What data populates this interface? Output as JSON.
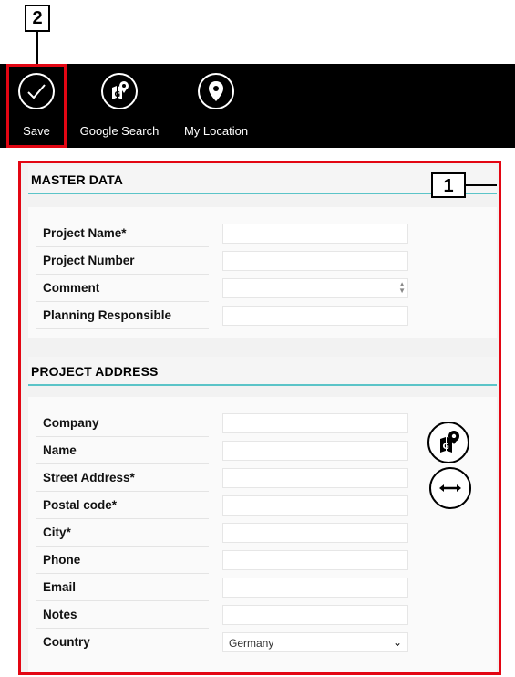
{
  "callouts": {
    "c1": "1",
    "c2": "2"
  },
  "toolbar": {
    "save_label": "Save",
    "google_label": "Google Search",
    "location_label": "My Location"
  },
  "sections": {
    "master": {
      "title": "MASTER DATA",
      "fields": [
        {
          "label": "Project Name*",
          "value": ""
        },
        {
          "label": "Project Number",
          "value": ""
        },
        {
          "label": "Comment",
          "value": ""
        },
        {
          "label": "Planning Responsible",
          "value": ""
        }
      ]
    },
    "address": {
      "title": "PROJECT ADDRESS",
      "fields": [
        {
          "label": "Company",
          "value": ""
        },
        {
          "label": "Name",
          "value": ""
        },
        {
          "label": "Street Address*",
          "value": ""
        },
        {
          "label": "Postal code*",
          "value": ""
        },
        {
          "label": "City*",
          "value": ""
        },
        {
          "label": "Phone",
          "value": ""
        },
        {
          "label": "Email",
          "value": ""
        },
        {
          "label": "Notes",
          "value": ""
        },
        {
          "label": "Country",
          "value": "Germany"
        }
      ]
    }
  },
  "icons": {
    "save": "checkmark-icon",
    "google": "map-search-icon",
    "location": "location-pin-icon",
    "side_map": "map-search-icon",
    "side_swap": "swap-horizontal-icon"
  },
  "colors": {
    "highlight": "#e30613",
    "accent": "#5bc4c8",
    "toolbar": "#000000"
  }
}
